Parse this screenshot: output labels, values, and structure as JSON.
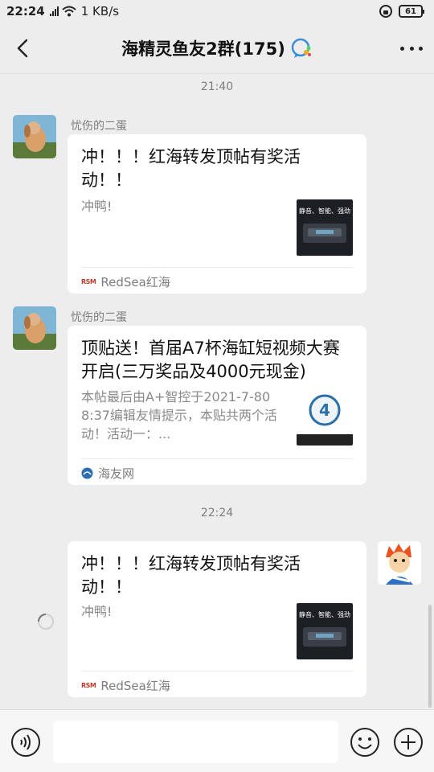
{
  "status_bar": {
    "time": "22:24",
    "network": "4G",
    "speed": "1 KB/s",
    "battery": "61"
  },
  "header": {
    "title": "海精灵鱼友2群(175)"
  },
  "messages": [
    {
      "timestamp": "21:40"
    },
    {
      "sender": "忧伤的二蛋",
      "title": "冲！！！红海转发顶帖有奖活动！！",
      "desc": "冲鸭!",
      "source": "RedSea红海",
      "thumb_text": "静音、智能、强劲"
    },
    {
      "sender": "忧伤的二蛋",
      "title": "顶贴送！首届A7杯海缸短视频大赛开启(三万奖品及4000元现金)",
      "desc": "本帖最后由A+智控于2021-7-808:37编辑友情提示，本贴共两个活动！活动一：...",
      "source": "海友网"
    },
    {
      "timestamp": "22:24"
    },
    {
      "title": "冲！！！红海转发顶帖有奖活动！！",
      "desc": "冲鸭!",
      "source": "RedSea红海",
      "thumb_text": "静音、智能、强劲"
    }
  ],
  "input": {
    "placeholder": ""
  },
  "colors": {
    "background": "#ededed",
    "card": "#ffffff",
    "muted_text": "#7d7d7d"
  }
}
